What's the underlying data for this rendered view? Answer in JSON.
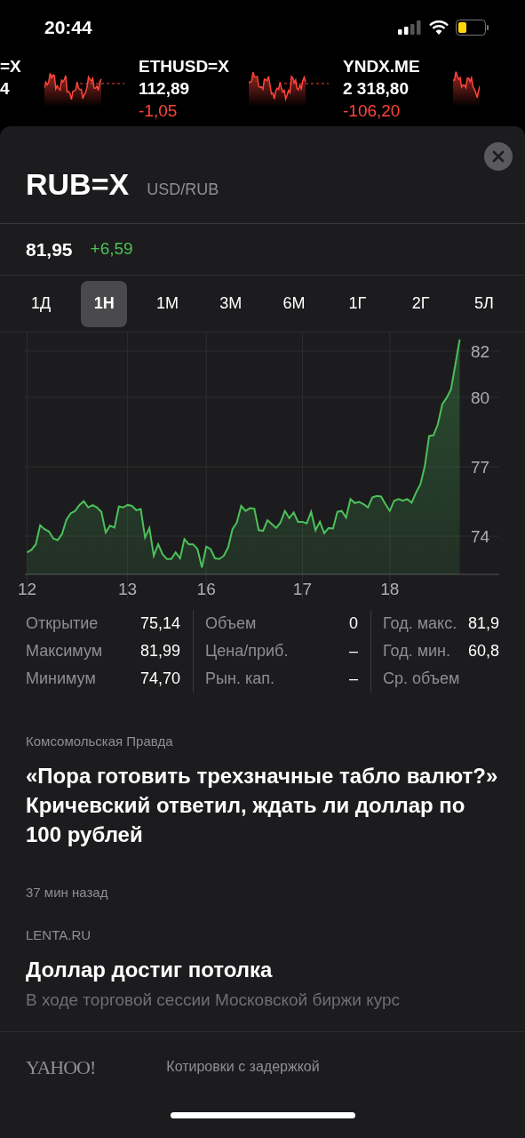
{
  "status_bar": {
    "time": "20:44"
  },
  "ticker": [
    {
      "symbol": "=X",
      "price": "4"
    },
    {
      "symbol": "ETHUSD=X",
      "price": "112,89",
      "change": "-1,05"
    },
    {
      "symbol": "YNDX.ME",
      "price": "2 318,80",
      "change": "-106,20"
    }
  ],
  "header": {
    "symbol": "RUB=X",
    "name": "USD/RUB",
    "price": "81,95",
    "change": "+6,59"
  },
  "tabs": [
    {
      "label": "1Д",
      "selected": false
    },
    {
      "label": "1Н",
      "selected": true
    },
    {
      "label": "1М",
      "selected": false
    },
    {
      "label": "3М",
      "selected": false
    },
    {
      "label": "6М",
      "selected": false
    },
    {
      "label": "1Г",
      "selected": false
    },
    {
      "label": "2Г",
      "selected": false
    },
    {
      "label": "5Л",
      "selected": false
    }
  ],
  "chart_data": {
    "type": "area",
    "grid": true,
    "ylim": [
      72.35,
      82.8
    ],
    "categories": [
      "12",
      null,
      null,
      null,
      null,
      null,
      null,
      null,
      null,
      null,
      null,
      null,
      null,
      null,
      null,
      null,
      null,
      null,
      null,
      null,
      null,
      null,
      null,
      "13",
      null,
      null,
      null,
      null,
      null,
      null,
      null,
      null,
      null,
      null,
      null,
      null,
      null,
      null,
      null,
      null,
      null,
      "16",
      null,
      null,
      null,
      null,
      null,
      null,
      null,
      null,
      null,
      null,
      null,
      null,
      null,
      null,
      null,
      null,
      null,
      null,
      null,
      null,
      null,
      "17",
      null,
      null,
      null,
      null,
      null,
      null,
      null,
      null,
      null,
      null,
      null,
      null,
      null,
      null,
      null,
      null,
      null,
      null,
      null,
      "18",
      null,
      null,
      null,
      null,
      null,
      null,
      null,
      null,
      null,
      null,
      null,
      null,
      null,
      null,
      null,
      null
    ],
    "yticks": [
      {
        "value": 82,
        "label": "82"
      },
      {
        "value": 80,
        "label": "80"
      },
      {
        "value": 77,
        "label": "77"
      },
      {
        "value": 74,
        "label": "74"
      }
    ],
    "series": [
      {
        "color": "#4cc15a",
        "values": [
          73.3,
          73.41,
          73.65,
          74.47,
          74.3,
          74.2,
          73.9,
          73.83,
          74.09,
          74.7,
          74.99,
          75.09,
          75.35,
          75.51,
          75.24,
          75.34,
          75.24,
          75.05,
          74.16,
          74.45,
          74.37,
          75.28,
          75.24,
          75.35,
          75.31,
          75.12,
          75.17,
          73.94,
          74.35,
          73.15,
          73.65,
          73.22,
          73.01,
          73.01,
          73.3,
          73.04,
          73.87,
          73.65,
          73.65,
          73.44,
          72.65,
          73.55,
          73.44,
          73.04,
          73.01,
          73.15,
          73.51,
          74.3,
          74.59,
          75.31,
          75.09,
          75.21,
          75.19,
          74.26,
          74.23,
          74.69,
          74.52,
          74.35,
          74.59,
          75.09,
          74.78,
          75.02,
          74.62,
          74.62,
          74.55,
          75.05,
          74.26,
          74.62,
          74.13,
          74.35,
          74.33,
          75.05,
          75.09,
          74.8,
          75.6,
          75.43,
          75.48,
          75.38,
          75.24,
          75.67,
          75.74,
          75.71,
          75.38,
          75.09,
          75.53,
          75.6,
          75.53,
          75.6,
          75.45,
          75.88,
          76.24,
          77.03,
          78.33,
          78.36,
          78.83,
          79.7,
          79.98,
          80.34,
          81.42,
          82.5
        ]
      }
    ]
  },
  "stats": [
    [
      {
        "label": "Открытие",
        "value": "75,14"
      },
      {
        "label": "Максимум",
        "value": "81,99"
      },
      {
        "label": "Минимум",
        "value": "74,70"
      }
    ],
    [
      {
        "label": "Объем",
        "value": "0"
      },
      {
        "label": "Цена/приб.",
        "value": "–"
      },
      {
        "label": "Рын. кап.",
        "value": "–"
      }
    ],
    [
      {
        "label": "Год. макс.",
        "value": "81,9"
      },
      {
        "label": "Год. мин.",
        "value": "60,8"
      },
      {
        "label": "Ср. объем"
      }
    ]
  ],
  "news": [
    {
      "source": "Комсомольская Правда",
      "headline": "«Пора готовить трехзначные табло валют?» Кричевский ответил, ждать ли доллар по 100 рублей",
      "time": "37 мин назад"
    },
    {
      "source": "LENTA.RU",
      "headline": "Доллар достиг потолка",
      "preview": "В ходе торговой сессии Московской биржи курс"
    }
  ],
  "footer": {
    "logo": "YAHOO!",
    "note": "Котировки с задержкой"
  }
}
